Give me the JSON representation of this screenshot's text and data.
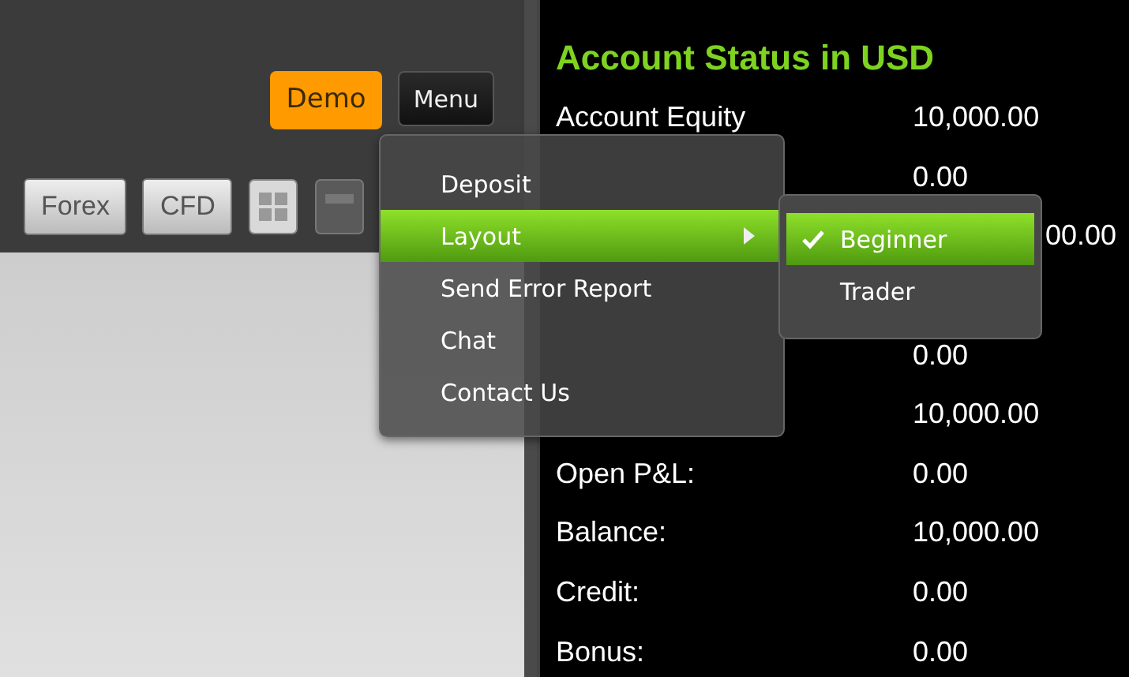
{
  "header": {
    "demo_badge": "Demo",
    "menu_button": "Menu"
  },
  "toolbar": {
    "tabs": [
      {
        "label": "Forex",
        "selected": false
      },
      {
        "label": "CFD",
        "selected": false
      }
    ]
  },
  "menu": {
    "items": [
      {
        "label": "Deposit",
        "selected": false,
        "has_submenu": false
      },
      {
        "label": "Layout",
        "selected": true,
        "has_submenu": true
      },
      {
        "label": "Send Error Report",
        "selected": false,
        "has_submenu": false
      },
      {
        "label": "Chat",
        "selected": false,
        "has_submenu": false
      },
      {
        "label": "Contact Us",
        "selected": false,
        "has_submenu": false
      }
    ],
    "submenu": {
      "items": [
        {
          "label": "Beginner",
          "checked": true,
          "selected": true
        },
        {
          "label": "Trader",
          "checked": false,
          "selected": false
        }
      ]
    }
  },
  "account": {
    "title": "Account Status in USD",
    "rows": [
      {
        "label": "Account Equity",
        "value": "10,000.00"
      },
      {
        "value": "0.00"
      },
      {
        "value": "00.00",
        "covered": true
      },
      {
        "covered": true
      },
      {
        "value": "0.00"
      },
      {
        "value": "10,000.00"
      },
      {
        "label": "Open P&L:",
        "value": "0.00"
      },
      {
        "label": "Balance:",
        "value": "10,000.00"
      },
      {
        "label": "Credit:",
        "value": "0.00"
      },
      {
        "label": "Bonus:",
        "value": "0.00"
      }
    ]
  }
}
